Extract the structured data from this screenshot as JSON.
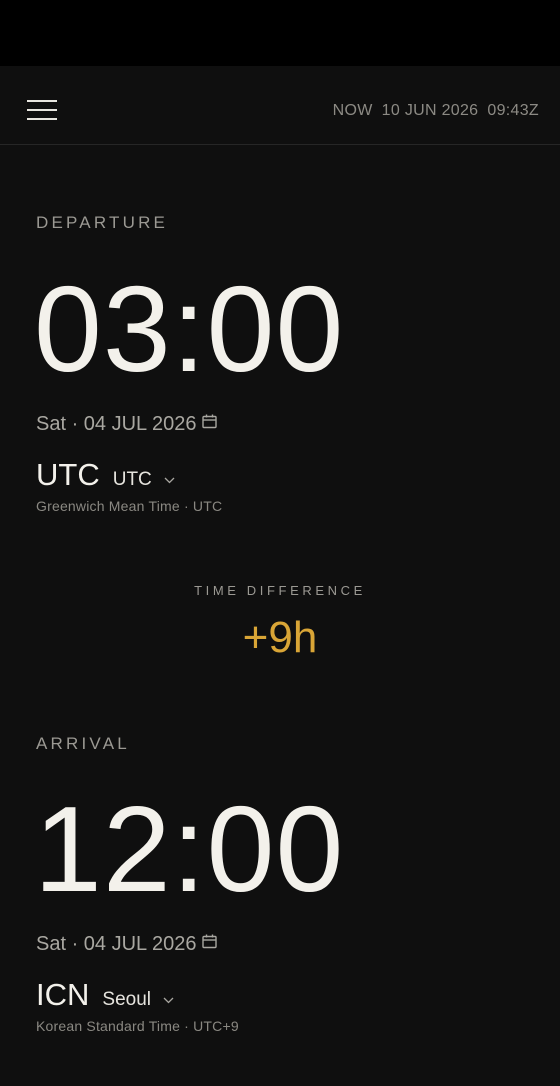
{
  "header": {
    "now_label": "NOW",
    "now_date": "10 JUN 2026",
    "now_time": "09:43Z"
  },
  "departure": {
    "label": "DEPARTURE",
    "time": "03:00",
    "date": "Sat · 04 JUL 2026",
    "zone_code": "UTC",
    "zone_select": "UTC",
    "zone_desc": "Greenwich Mean Time · UTC"
  },
  "difference": {
    "label": "TIME DIFFERENCE",
    "value": "+9h",
    "color": "#d9a536"
  },
  "arrival": {
    "label": "ARRIVAL",
    "time": "12:00",
    "date": "Sat · 04 JUL 2026",
    "zone_code": "ICN",
    "zone_select": "Seoul",
    "zone_desc": "Korean Standard Time · UTC+9"
  },
  "icons": {
    "menu": "menu-icon",
    "calendar": "calendar-icon",
    "chevron": "chevron-down-icon"
  }
}
